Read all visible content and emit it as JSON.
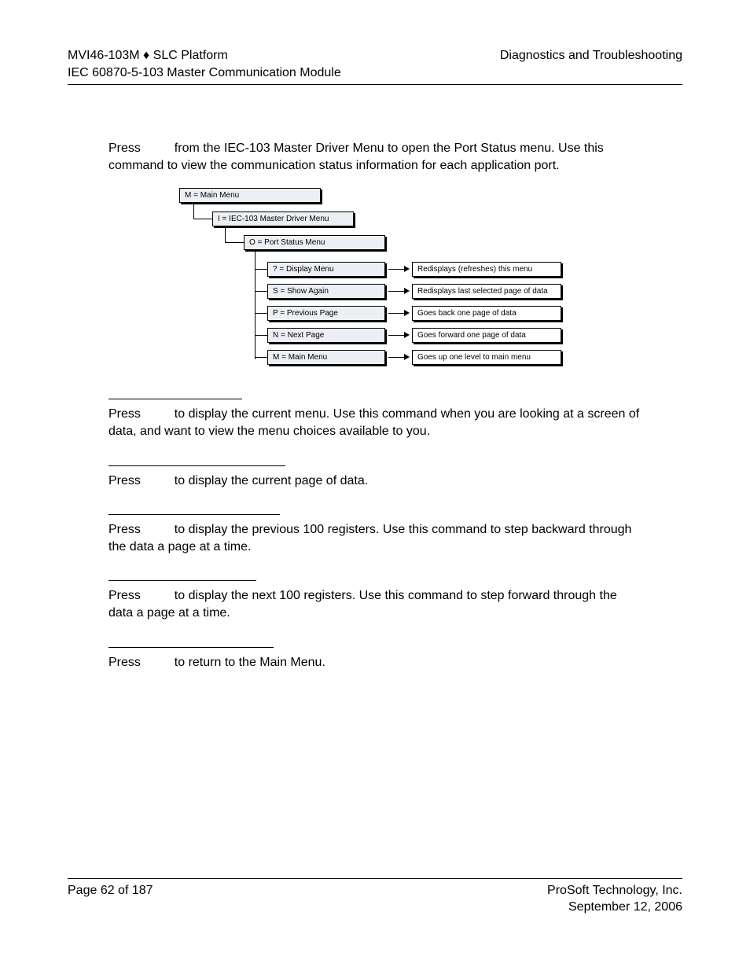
{
  "header": {
    "left_line1_a": "MVI46-103M ",
    "bullet": "♦",
    "left_line1_b": " SLC Platform",
    "left_line2": "IEC 60870-5-103 Master Communication Module",
    "right_line1": "Diagnostics and Troubleshooting"
  },
  "intro": {
    "press": "Press ",
    "rest": " from the IEC-103 Master Driver Menu to open the Port Status menu. Use this command to view the communication status information for each application port."
  },
  "diagram": {
    "m_main": "M = Main Menu",
    "i_driver": "I = IEC-103 Master Driver Menu",
    "o_port": "O = Port Status Menu",
    "items": [
      {
        "label": "? = Display Menu",
        "desc": "Redisplays (refreshes) this menu"
      },
      {
        "label": "S = Show Again",
        "desc": "Redisplays last selected page of data"
      },
      {
        "label": "P = Previous Page",
        "desc": "Goes back one page of data"
      },
      {
        "label": "N = Next Page",
        "desc": "Goes forward one page of data"
      },
      {
        "label": "M = Main Menu",
        "desc": "Goes up one level to main menu"
      }
    ]
  },
  "sections": [
    {
      "rule_w": "w170",
      "press": "Press ",
      "text": " to display the current menu. Use this command when you are looking at a screen of data, and want to view the menu choices available to you."
    },
    {
      "rule_w": "w225",
      "press": "Press ",
      "text": " to display the current page of data."
    },
    {
      "rule_w": "w218",
      "press": "Press ",
      "text": " to display the previous 100 registers. Use this command to step backward through the data a page at a time."
    },
    {
      "rule_w": "w188",
      "press": "Press ",
      "text": " to display the next 100 registers. Use this command to step forward through the data a page at a time."
    },
    {
      "rule_w": "w210",
      "press": "Press ",
      "text": " to return to the Main Menu."
    }
  ],
  "footer": {
    "left": "Page 62 of 187",
    "right1": "ProSoft Technology, Inc.",
    "right2": "September 12, 2006"
  }
}
